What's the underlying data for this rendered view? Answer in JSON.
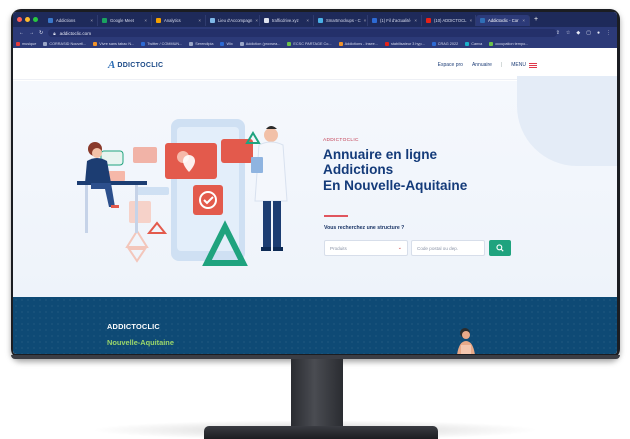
{
  "browser": {
    "tabs": [
      {
        "label": "Addictions",
        "favicon_color": "#3a78c9",
        "active": false
      },
      {
        "label": "Google Meet",
        "favicon_color": "#1aa260",
        "active": false
      },
      {
        "label": "Analytics",
        "favicon_color": "#f4a000",
        "active": false
      },
      {
        "label": "Lieu d'Accompagn",
        "favicon_color": "#7fb8e8",
        "active": false
      },
      {
        "label": "trafficdrive.xyz",
        "favicon_color": "#dfe3ee",
        "active": false
      },
      {
        "label": "Smartmockups - C",
        "favicon_color": "#4ab0e6",
        "active": false
      },
      {
        "label": "(1) Fil d'actualité",
        "favicon_color": "#2d6ad4",
        "active": false
      },
      {
        "label": "(10) ADDICTOCL",
        "favicon_color": "#e62117",
        "active": false
      },
      {
        "label": "Addictoclic - Cor",
        "favicon_color": "#2f6fb6",
        "active": true
      }
    ],
    "url": "addictoclic.com",
    "bookmarks": [
      {
        "label": "musique",
        "color": "#e63a3a"
      },
      {
        "label": "CORRASID Nouvell...",
        "color": "#9aa6c7"
      },
      {
        "label": "Vivre sans tabac N...",
        "color": "#f0932b"
      },
      {
        "label": "Twitter / COMMUN...",
        "color": "#2d6ad4"
      },
      {
        "label": "Serendipia",
        "color": "#9aa6c7"
      },
      {
        "label": "Wix",
        "color": "#2d6ad4"
      },
      {
        "label": "Addiction (proxsea...",
        "color": "#9aa6c7"
      },
      {
        "label": "ECSC PARTAGE Co...",
        "color": "#6cc24a"
      },
      {
        "label": "Addictions - Insee...",
        "color": "#f0932b"
      },
      {
        "label": "stabilisateur 3 hyp...",
        "color": "#e62117"
      },
      {
        "label": "CRAG 2022",
        "color": "#2d6ad4"
      },
      {
        "label": "Canva",
        "color": "#1ab0c9"
      },
      {
        "label": "occupation tempo...",
        "color": "#6cc24a"
      }
    ]
  },
  "site": {
    "logo_mark": "A",
    "logo_text": "DDICTOCLIC",
    "nav": {
      "espace_pro": "Espace pro",
      "annuaire": "Annuaire",
      "menu": "MENU"
    },
    "hero": {
      "eyebrow": "ADDICTOCLIC",
      "title_line1": "Annuaire en ligne",
      "title_line2": "Addictions",
      "title_line3": "En Nouvelle-Aquitaine",
      "question": "Vous recherchez une structure ?",
      "select_value": "Produits",
      "postal_placeholder": "Code postal ou dep."
    },
    "band": {
      "title": "ADDICTOCLIC",
      "subtitle": "Nouvelle-Aquitaine"
    }
  },
  "colors": {
    "primary_navy": "#143b7a",
    "accent_red": "#e0555e",
    "accent_green": "#1fa37e",
    "band_blue": "#0e4a75",
    "band_green": "#9bd66a"
  }
}
